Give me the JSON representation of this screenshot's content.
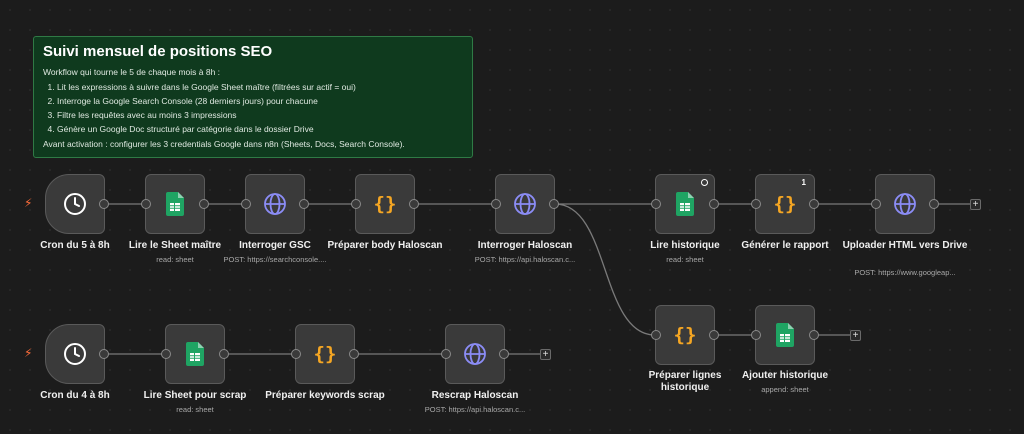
{
  "sticky_note": {
    "title": "Suivi mensuel de positions SEO",
    "intro": "Workflow qui tourne le 5 de chaque mois à 8h :",
    "steps": [
      "Lit les expressions à suivre dans le Google Sheet maître (filtrées sur actif = oui)",
      "Interroge la Google Search Console (28 derniers jours) pour chacune",
      "Filtre les requêtes avec au moins 3 impressions",
      "Génère un Google Doc structuré par catégorie dans le dossier Drive"
    ],
    "outro": "Avant activation : configurer les 3 credentials Google dans n8n (Sheets, Docs, Search Console)."
  },
  "nodes": {
    "cron5": {
      "label": "Cron du 5 à 8h",
      "icon": "clock-icon"
    },
    "lire_sheet_maitre": {
      "label": "Lire le Sheet maître",
      "sub": "read: sheet",
      "icon": "google-sheets-icon"
    },
    "interroger_gsc": {
      "label": "Interroger GSC",
      "sub": "POST: https://searchconsole....",
      "icon": "globe-icon"
    },
    "preparer_body_haloscan": {
      "label": "Préparer body Haloscan",
      "icon": "code-braces-icon"
    },
    "interroger_haloscan": {
      "label": "Interroger Haloscan",
      "sub": "POST: https://api.haloscan.c...",
      "icon": "globe-icon"
    },
    "lire_historique": {
      "label": "Lire historique",
      "sub": "read: sheet",
      "icon": "google-sheets-icon"
    },
    "generer_rapport": {
      "label": "Générer le rapport",
      "badge": "1",
      "icon": "code-braces-icon"
    },
    "uploader_html": {
      "label": "Uploader HTML vers Drive",
      "sub": "POST: https://www.googleap...",
      "icon": "globe-icon"
    },
    "preparer_lignes_historique": {
      "label": "Préparer lignes historique",
      "icon": "code-braces-icon"
    },
    "ajouter_historique": {
      "label": "Ajouter historique",
      "sub": "append: sheet",
      "icon": "google-sheets-icon"
    },
    "cron4": {
      "label": "Cron du 4 à 8h",
      "icon": "clock-icon"
    },
    "lire_sheet_scrap": {
      "label": "Lire Sheet pour scrap",
      "sub": "read: sheet",
      "icon": "google-sheets-icon"
    },
    "preparer_keywords_scrap": {
      "label": "Préparer keywords scrap",
      "icon": "code-braces-icon"
    },
    "rescrap_haloscan": {
      "label": "Rescrap Haloscan",
      "sub": "POST: https://api.haloscan.c...",
      "icon": "globe-icon"
    }
  },
  "add_button_label": "+",
  "colors": {
    "accent_trigger": "#ff6d3a",
    "sheets_green": "#1fa463",
    "http_purple": "#8b8cf5",
    "code_orange": "#f5a623"
  }
}
